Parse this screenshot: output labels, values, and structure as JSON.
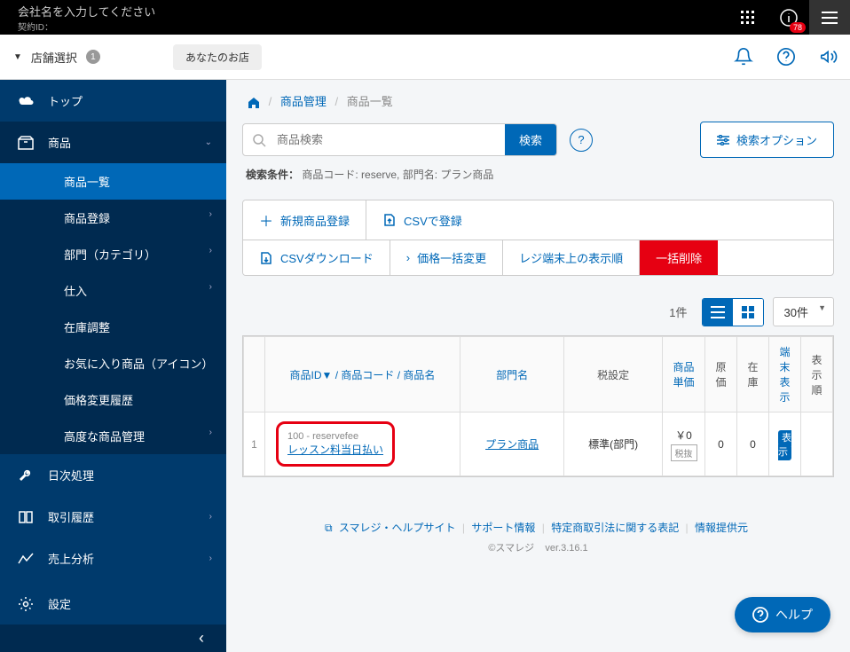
{
  "topbar": {
    "company_placeholder": "会社名を入力してください",
    "contract_label": "契約ID：",
    "badge": "78"
  },
  "storebar": {
    "label": "店舗選択",
    "count": "1",
    "chip": "あなたのお店"
  },
  "sidebar": {
    "top": "トップ",
    "products": "商品",
    "sub": {
      "list": "商品一覧",
      "register": "商品登録",
      "dept": "部門（カテゴリ）",
      "purchase": "仕入",
      "stock": "在庫調整",
      "fav": "お気に入り商品（アイコン）",
      "price_history": "価格変更履歴",
      "advanced": "高度な商品管理"
    },
    "daily": "日次処理",
    "history": "取引履歴",
    "analytics": "売上分析",
    "settings": "設定"
  },
  "breadcrumb": {
    "l1": "商品管理",
    "l2": "商品一覧"
  },
  "search": {
    "placeholder": "商品検索",
    "button": "検索",
    "options": "検索オプション",
    "cond_label": "検索条件：",
    "cond_value": "商品コード: reserve, 部門名: プラン商品"
  },
  "actions": {
    "new": "新規商品登録",
    "csv_up": "CSVで登録",
    "csv_down": "CSVダウンロード",
    "bulk_price": "価格一括変更",
    "terminal_order": "レジ端末上の表示順",
    "bulk_delete": "一括削除"
  },
  "results": {
    "count": "1件",
    "page_size": "30件"
  },
  "table": {
    "headers": {
      "id_code_name": "商品ID▼ / 商品コード / 商品名",
      "dept": "部門名",
      "tax": "税設定",
      "price": "商品単価",
      "cost": "原価",
      "stock": "在庫",
      "terminal": "端末表示",
      "order": "表示順"
    },
    "rows": [
      {
        "num": "1",
        "code": "100 - reservefee",
        "name": "レッスン料当日払い",
        "dept": "プラン商品",
        "tax": "標準(部門)",
        "price": "￥0",
        "tax_badge": "税抜",
        "cost": "0",
        "stock": "0",
        "terminal": "表示",
        "order": ""
      }
    ]
  },
  "footer": {
    "help_site": "スマレジ・ヘルプサイト",
    "support": "サポート情報",
    "law": "特定商取引法に関する表記",
    "provider": "情報提供元",
    "copyright": "©スマレジ",
    "version": "ver.3.16.1"
  },
  "help_float": "ヘルプ"
}
